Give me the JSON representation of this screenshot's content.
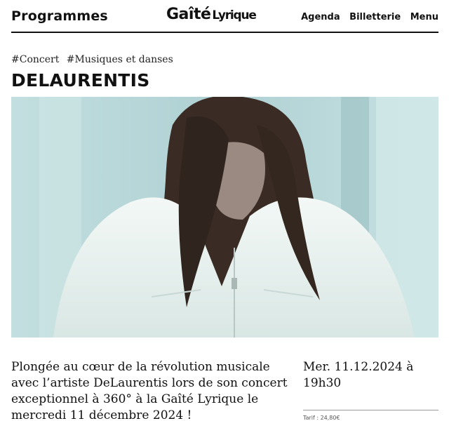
{
  "header": {
    "programmes_label": "Programmes",
    "logo_main": "Gaîté",
    "logo_sub": "Lyrique",
    "nav": {
      "agenda": "Agenda",
      "billetterie": "Billetterie",
      "menu": "Menu"
    }
  },
  "event": {
    "tags": [
      "#Concert",
      "#Musiques et danses"
    ],
    "title": "DELAURENTIS",
    "description": "Plongée au cœur de la révolution musicale avec l’artiste DeLaurentis lors de son concert exceptionnel à 360° à la Gaîté Lyrique le mercredi 11 décembre 2024 !",
    "date": "Mer. 11.12.2024 à 19h30",
    "tarif": "Tarif : 24,80€"
  },
  "colors": {
    "text": "#111111",
    "photo_bg": "#b7d6d8",
    "jacket": "#e9f1ef",
    "hair": "#3a2c24"
  },
  "icons": {
    "hero": "artist-photo"
  }
}
